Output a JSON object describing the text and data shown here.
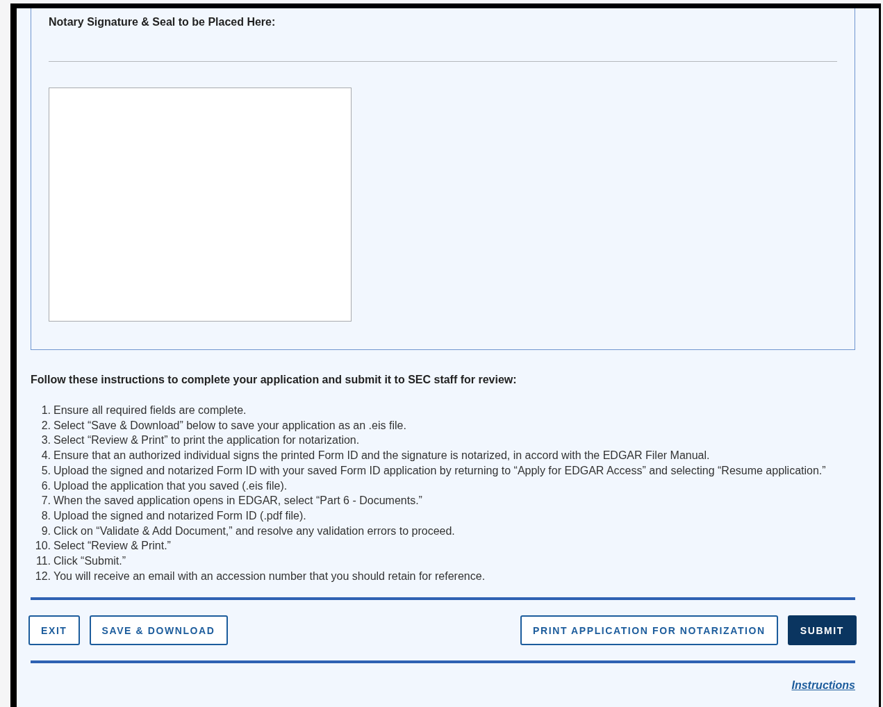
{
  "notary_section": {
    "heading": "Notary Signature & Seal to be Placed Here:"
  },
  "instructions": {
    "heading": "Follow these instructions to complete your application and submit it to SEC staff for review:",
    "steps": [
      {
        "number": "1.",
        "text": "Ensure all required fields are complete."
      },
      {
        "number": "2.",
        "text": "Select “Save & Download” below to save your application as an .eis file."
      },
      {
        "number": "3.",
        "text": "Select “Review & Print” to print the application for notarization."
      },
      {
        "number": "4.",
        "text": "Ensure that an authorized individual signs the printed Form ID and the signature is notarized, in accord with the EDGAR Filer Manual."
      },
      {
        "number": "5.",
        "text": "Upload the signed and notarized Form ID with your saved Form ID application by returning to “Apply for EDGAR Access” and selecting “Resume application.”"
      },
      {
        "number": "6.",
        "text": "Upload the application that you saved (.eis file)."
      },
      {
        "number": "7.",
        "text": "When the saved application opens in EDGAR, select “Part 6 - Documents.”"
      },
      {
        "number": "8.",
        "text": "Upload the signed and notarized Form ID (.pdf file)."
      },
      {
        "number": "9.",
        "text": "Click on “Validate & Add Document,” and resolve any validation errors to proceed."
      },
      {
        "number": "10.",
        "text": "Select “Review & Print.”"
      },
      {
        "number": "11.",
        "text": "Click “Submit.”"
      },
      {
        "number": "12.",
        "text": "You will receive an email with an accession number that you should retain for reference."
      }
    ]
  },
  "left_buttons": [
    {
      "label": "EXIT",
      "kind": "outline"
    },
    {
      "label": "SAVE & DOWNLOAD",
      "kind": "outline"
    }
  ],
  "right_buttons": [
    {
      "label": "PRINT APPLICATION FOR NOTARIZATION",
      "kind": "outline"
    },
    {
      "label": "SUBMIT",
      "kind": "primary"
    }
  ],
  "footer_link": "Instructions"
}
